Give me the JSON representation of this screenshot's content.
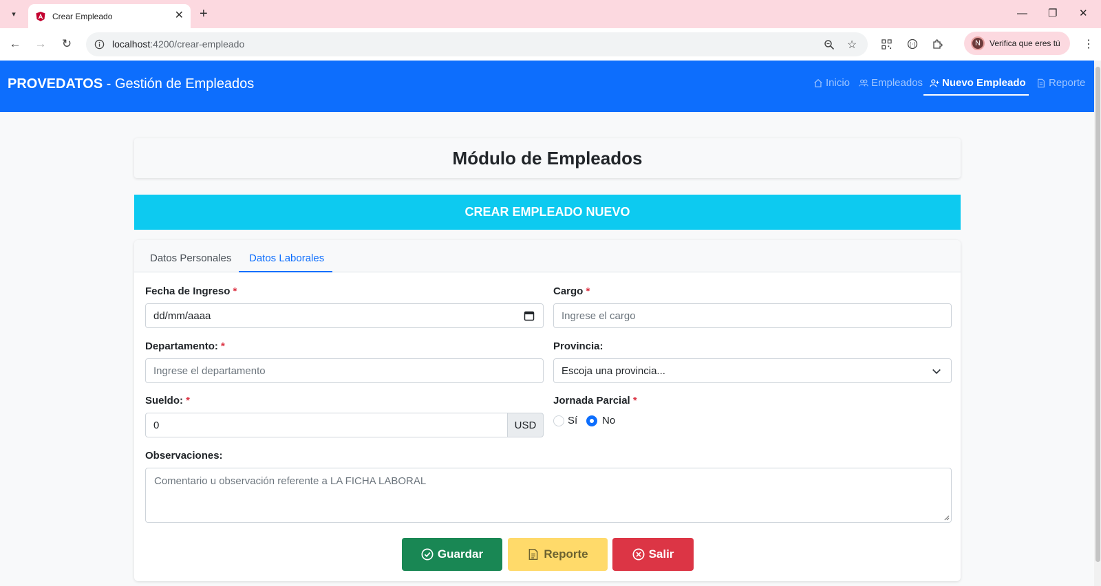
{
  "browser": {
    "tab_title": "Crear Empleado",
    "url_host": "localhost",
    "url_rest": ":4200/crear-empleado",
    "profile_initial": "N",
    "profile_text": "Verifica que eres tú"
  },
  "navbar": {
    "brand": "PROVEDATOS",
    "subtitle": " - Gestión de Empleados",
    "items": [
      {
        "label": "Inicio",
        "icon": "home-icon",
        "active": false
      },
      {
        "label": "Empleados",
        "icon": "people-icon",
        "active": false
      },
      {
        "label": "Nuevo Empleado",
        "icon": "person-add-icon",
        "active": true
      },
      {
        "label": "Reporte",
        "icon": "document-icon",
        "active": false
      }
    ]
  },
  "page": {
    "title": "Módulo de Empleados",
    "banner": "CREAR EMPLEADO NUEVO"
  },
  "tabs": {
    "personal": "Datos Personales",
    "laboral": "Datos Laborales",
    "active": "Datos Laborales"
  },
  "form": {
    "fecha_label": "Fecha de Ingreso",
    "fecha_value": "dd/mm/aaaa",
    "cargo_label": "Cargo",
    "cargo_placeholder": "Ingrese el cargo",
    "departamento_label": "Departamento:",
    "departamento_placeholder": "Ingrese el departamento",
    "provincia_label": "Provincia:",
    "provincia_value": "Escoja una provincia...",
    "sueldo_label": "Sueldo:",
    "sueldo_value": "0",
    "sueldo_currency": "USD",
    "jornada_label": "Jornada Parcial",
    "jornada_si": "Sí",
    "jornada_no": "No",
    "jornada_selected": "No",
    "observaciones_label": "Observaciones:",
    "observaciones_placeholder": "Comentario u observación referente a LA FICHA LABORAL",
    "required_mark": "*"
  },
  "buttons": {
    "guardar": "Guardar",
    "reporte": "Reporte",
    "salir": "Salir"
  },
  "colors": {
    "primary": "#0d6efd",
    "info": "#0dcaf0",
    "success": "#198754",
    "warning": "#ffda6a",
    "danger": "#dc3545"
  }
}
